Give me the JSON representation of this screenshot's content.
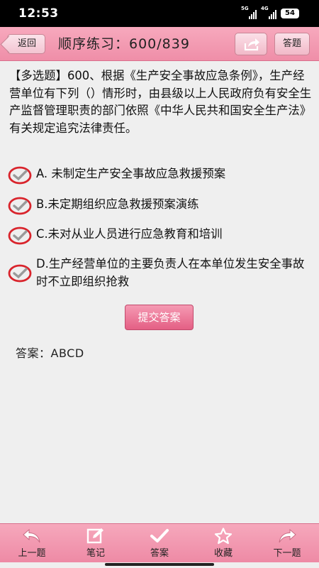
{
  "status_bar": {
    "time": "12:53",
    "signal1_tag": "5G",
    "signal2_tag": "4G",
    "battery": "54"
  },
  "header": {
    "back_label": "返回",
    "title": "顺序练习：600/839",
    "answer_sheet_label": "答题"
  },
  "question": {
    "text": "【多选题】600、根据《生产安全事故应急条例》，生产经营单位有下列（）情形时，由县级以上人民政府负有安全生产监督管理职责的部门依照《中华人民共和国安全生产法》有关规定追究法律责任。",
    "options": [
      {
        "text": "A. 未制定生产安全事故应急救援预案",
        "checked": true
      },
      {
        "text": "B.未定期组织应急救援预案演练",
        "checked": true
      },
      {
        "text": "C.未对从业人员进行应急教育和培训",
        "checked": true
      },
      {
        "text": "D.生产经营单位的主要负责人在本单位发生安全事故时不立即组织抢救",
        "checked": true
      }
    ]
  },
  "submit_label": "提交答案",
  "answer_text": "答案：ABCD",
  "bottom_nav": {
    "prev": "上一题",
    "notes": "笔记",
    "answer": "答案",
    "favorite": "收藏",
    "next": "下一题"
  },
  "colors": {
    "accent": "#ef8ea8",
    "button": "#e45f84",
    "check_ring": "#d9242c",
    "check_mark": "#9a9a9a"
  }
}
